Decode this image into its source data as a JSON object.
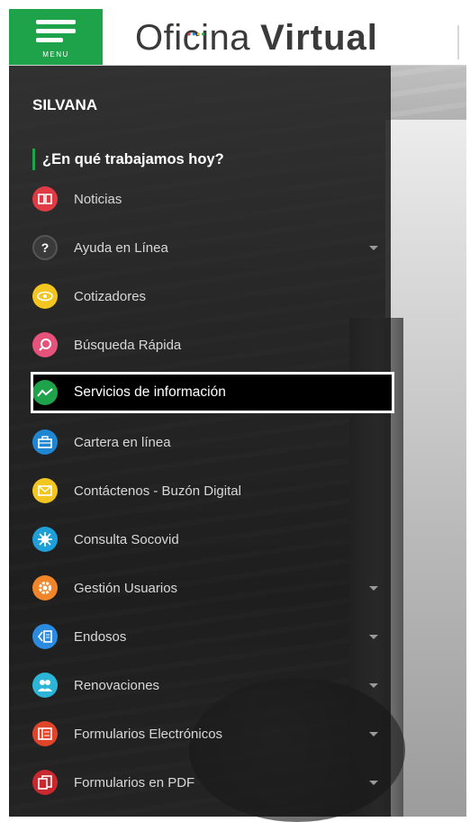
{
  "header": {
    "menu_label": "MENU",
    "brand_word1": "Oficina",
    "brand_word2": "Virtual",
    "brand_color": "#3a3a3a",
    "menu_button_color": "#1fa34a"
  },
  "user": {
    "name": "SILVANA"
  },
  "prompt": "¿En qué trabajamos hoy?",
  "menu": {
    "items": [
      {
        "label": "Noticias",
        "icon": "newspaper-icon",
        "icon_color": "#e03a44",
        "has_submenu": false
      },
      {
        "label": "Ayuda en Línea",
        "icon": "question-icon",
        "icon_color": "#3a3a3a",
        "has_submenu": true
      },
      {
        "label": "Cotizadores",
        "icon": "eye-icon",
        "icon_color": "#f2c521",
        "has_submenu": false
      },
      {
        "label": "Búsqueda Rápida",
        "icon": "search-icon",
        "icon_color": "#e5527a",
        "has_submenu": false
      },
      {
        "label": "Servicios de información",
        "icon": "chart-line-icon",
        "icon_color": "#1fa34a",
        "has_submenu": false,
        "active": true
      },
      {
        "label": "Cartera en línea",
        "icon": "briefcase-icon",
        "icon_color": "#1f86d1",
        "has_submenu": false
      },
      {
        "label": "Contáctenos - Buzón Digital",
        "icon": "mail-icon",
        "icon_color": "#f2c521",
        "has_submenu": false
      },
      {
        "label": "Consulta Socovid",
        "icon": "virus-icon",
        "icon_color": "#1f9fd8",
        "has_submenu": false
      },
      {
        "label": "Gestión Usuarios",
        "icon": "gear-icon",
        "icon_color": "#f0852a",
        "has_submenu": true
      },
      {
        "label": "Endosos",
        "icon": "document-icon",
        "icon_color": "#2a8be0",
        "has_submenu": true
      },
      {
        "label": "Renovaciones",
        "icon": "users-icon",
        "icon_color": "#2db5d8",
        "has_submenu": true
      },
      {
        "label": "Formularios Electrónicos",
        "icon": "form-icon",
        "icon_color": "#e0452a",
        "has_submenu": true
      },
      {
        "label": "Formularios en PDF",
        "icon": "pdf-icon",
        "icon_color": "#c8282e",
        "has_submenu": true
      }
    ]
  }
}
